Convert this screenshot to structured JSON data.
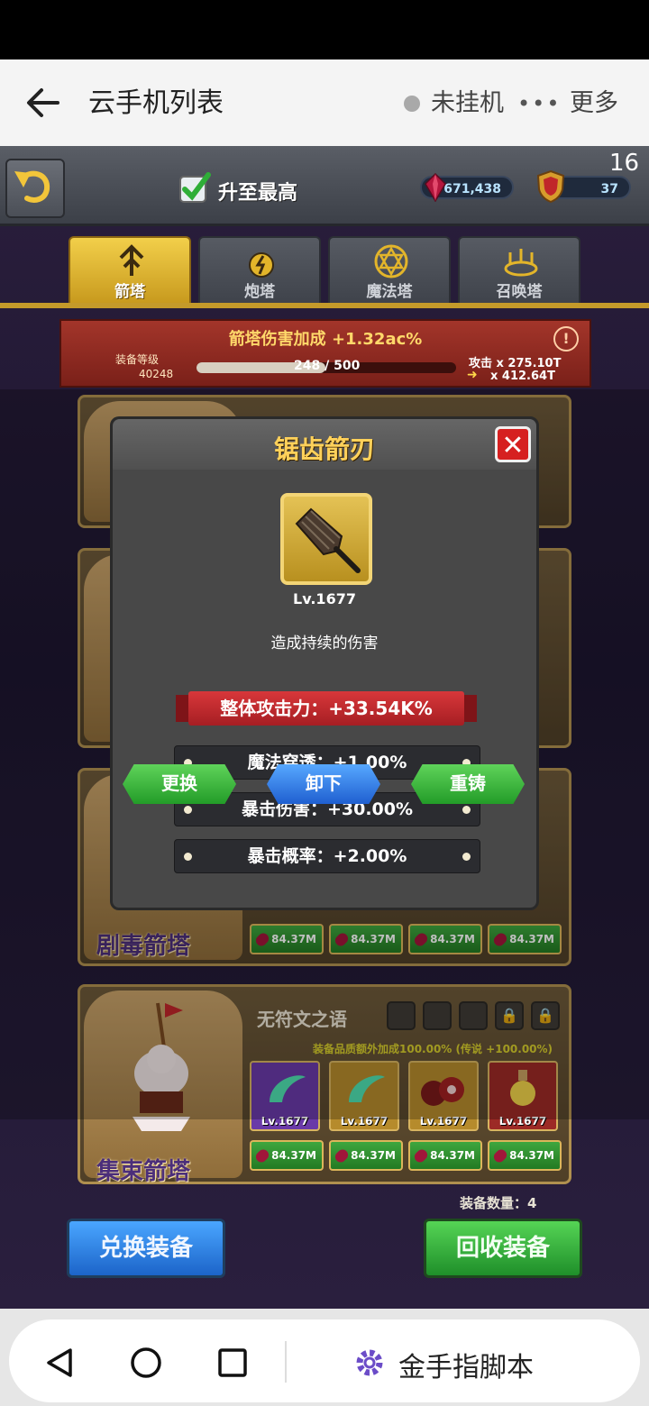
{
  "app_header": {
    "title": "云手机列表",
    "status": "未挂机",
    "more_dots": "•••",
    "more_label": "更多"
  },
  "game": {
    "fps": "16",
    "max_label": "升至最高",
    "gems": "671,438",
    "level": "37",
    "tabs": [
      {
        "label": "箭塔",
        "active": true
      },
      {
        "label": "炮塔",
        "active": false
      },
      {
        "label": "魔法塔",
        "active": false
      },
      {
        "label": "召唤塔",
        "active": false
      }
    ],
    "bonus": {
      "title": "箭塔伤害加成 +1.32ac%",
      "equip_level_label": "装备等级",
      "equip_level": "40248",
      "exp_text": "248 / 500",
      "exp_progress": 0.496,
      "attack_current": "攻击  x 275.10T",
      "attack_next": "x 412.64T",
      "info": "!"
    },
    "tower_names": [
      "剧毒箭塔",
      "集束箭塔"
    ],
    "cards": {
      "rune_title": "无符文之语",
      "quality_bonus": "装备品质额外加成100.00% (传说 +100.00%)",
      "items": [
        {
          "level": "Lv.1677",
          "color": "#6a3aa8"
        },
        {
          "level": "Lv.1677",
          "color": "#b68b2c"
        },
        {
          "level": "Lv.1677",
          "color": "#b68b2c"
        },
        {
          "level": "Lv.1677",
          "color": "#9c2a26"
        }
      ],
      "recycle_value": "84.37M"
    },
    "equip_count": "装备数量：4",
    "exchange_label": "兑换装备",
    "recycle_label": "回收装备"
  },
  "modal": {
    "title": "锯齿箭刃",
    "close_glyph": "✕",
    "item_level": "Lv.1677",
    "description": "造成持续的伤害",
    "main_stat": "整体攻击力：+33.54K%",
    "sub_stats": [
      "魔法穿透：+1.00%",
      "暴击伤害：+30.00%",
      "暴击概率：+2.00%"
    ],
    "actions": {
      "replace": "更换",
      "unequip": "卸下",
      "reforge": "重铸"
    }
  },
  "nav": {
    "script_label": "金手指脚本"
  },
  "colors": {
    "accent_gold": "#ffd15a",
    "stat_red": "#c02a2e",
    "button_green": "#239c28",
    "button_blue": "#1f5fd0"
  }
}
